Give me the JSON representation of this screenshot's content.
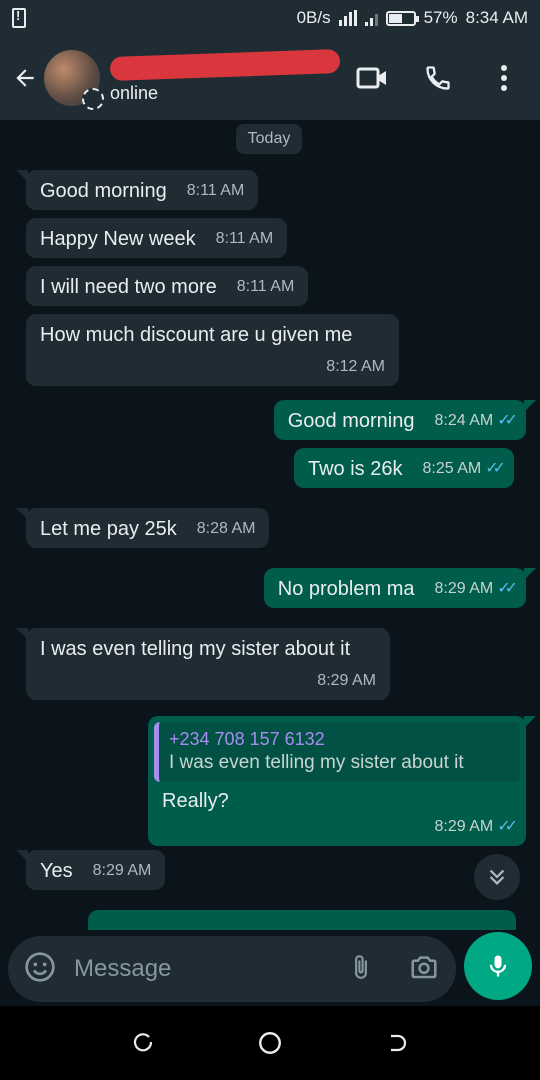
{
  "status_bar": {
    "speed": "0B/s",
    "battery": "57%",
    "battery_level": 0.57,
    "time": "8:34 AM"
  },
  "header": {
    "back_icon": "arrow-left-icon",
    "status": "online",
    "actions": [
      "video-call-icon",
      "phone-icon",
      "more-vert-icon"
    ]
  },
  "chat": {
    "date_label": "Today",
    "messages": [
      {
        "dir": "in",
        "text": "Good  morning",
        "time": "8:11 AM"
      },
      {
        "dir": "in",
        "text": "Happy  New  week",
        "time": "8:11 AM"
      },
      {
        "dir": "in",
        "text": "I will  need  two more",
        "time": "8:11 AM"
      },
      {
        "dir": "in",
        "text": "How much  discount  are u given  me",
        "time": "8:12 AM"
      },
      {
        "dir": "out",
        "text": "Good morning",
        "time": "8:24 AM",
        "ticks": "✓✓"
      },
      {
        "dir": "out",
        "text": "Two is 26k",
        "time": "8:25 AM",
        "ticks": "✓✓"
      },
      {
        "dir": "in",
        "text": "Let me pay 25k",
        "time": "8:28 AM"
      },
      {
        "dir": "out",
        "text": "No problem ma",
        "time": "8:29 AM",
        "ticks": "✓✓"
      },
      {
        "dir": "in",
        "text": "I was even telling  my sister  about it",
        "time": "8:29 AM"
      },
      {
        "dir": "out",
        "quote_author": "+234 708 157 6132",
        "quote_text": "I was even telling  my sister  about it",
        "text": "Really?",
        "time": "8:29 AM",
        "ticks": "✓✓"
      },
      {
        "dir": "in",
        "text": "Yes",
        "time": "8:29 AM"
      }
    ]
  },
  "input": {
    "placeholder": "Message"
  },
  "colors": {
    "background": "#0b141a",
    "bar": "#1f2c34",
    "incoming": "#1f2c34",
    "outgoing": "#005c4b",
    "accent": "#00a884",
    "read_ticks": "#53bdeb"
  }
}
